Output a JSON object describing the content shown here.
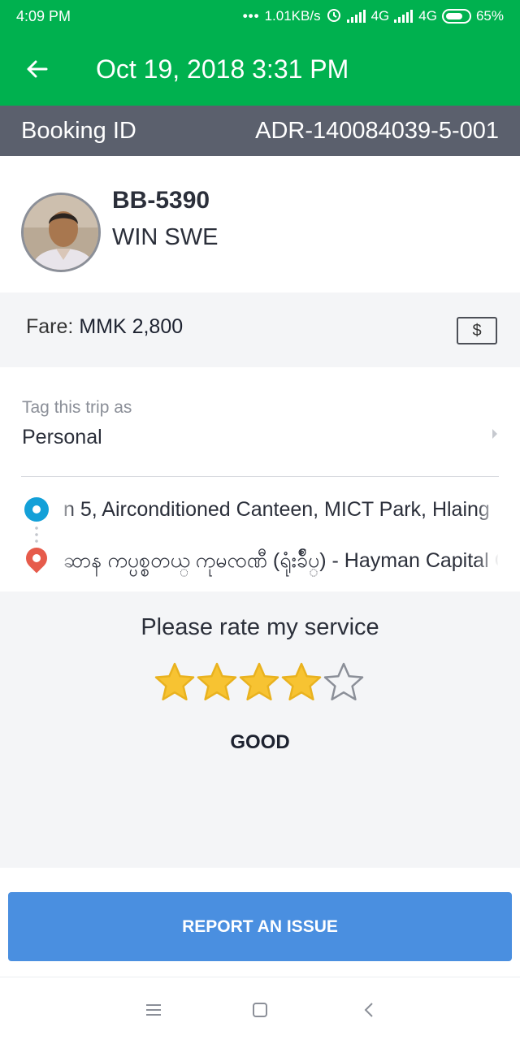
{
  "status_bar": {
    "time": "4:09 PM",
    "net_speed": "1.01KB/s",
    "net1": "4G",
    "net2": "4G",
    "battery": "65%",
    "icons": [
      "more-dots-icon",
      "alarm-icon",
      "signal-icon",
      "battery-icon"
    ]
  },
  "app_bar": {
    "title": "Oct 19, 2018 3:31 PM",
    "back_icon": "arrow-left-icon"
  },
  "booking": {
    "label": "Booking ID",
    "id": "ADR-140084039-5-001"
  },
  "driver": {
    "plate": "BB-5390",
    "name": "WIN SWE"
  },
  "fare": {
    "label": "Fare:",
    "amount": "MMK 2,800",
    "cash_symbol": "$"
  },
  "tag": {
    "label": "Tag this trip as",
    "value": "Personal"
  },
  "route": {
    "pickup": "n 5, Airconditioned Canteen, MICT Park, Hlaing",
    "dropoff": "ဆာန ကပ္ပစ္စတယ္ ကုမၸဏီ (ရုံးခ်ဳပ္) - Hayman Capital Co"
  },
  "rating": {
    "prompt": "Please rate my service",
    "stars": 4,
    "max_stars": 5,
    "label": "GOOD"
  },
  "actions": {
    "report": "REPORT AN ISSUE"
  },
  "colors": {
    "brand_green": "#00b14f",
    "booking_bar": "#5b606d",
    "star": "#f7c332",
    "report_blue": "#4a8fe0",
    "pickup": "#13a0d8",
    "dropoff": "#e65b4b"
  }
}
